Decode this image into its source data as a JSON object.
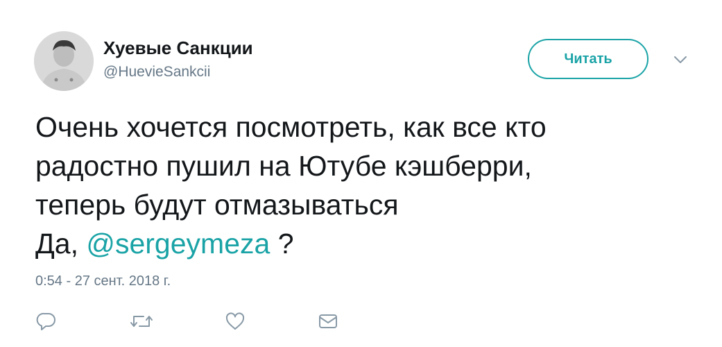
{
  "user": {
    "display_name": "Хуевые Санкции",
    "handle": "@HuevieSankcii"
  },
  "follow_button": {
    "label": "Читать"
  },
  "more_menu": {
    "icon": "chevron-down-icon"
  },
  "tweet": {
    "lines": [
      "Очень хочется посмотреть, как все кто",
      "радостно пушил на Ютубе кэшберри,",
      "теперь будут отмазываться"
    ],
    "last_line_prefix": "Да, ",
    "mention": "@sergeymeza",
    "last_line_suffix": " ?",
    "timestamp": "0:54 - 27 сент. 2018 г."
  },
  "actions": [
    {
      "name": "reply",
      "icon": "reply-icon"
    },
    {
      "name": "retweet",
      "icon": "retweet-icon"
    },
    {
      "name": "like",
      "icon": "heart-icon"
    },
    {
      "name": "direct-message",
      "icon": "envelope-icon"
    }
  ],
  "colors": {
    "accent": "#1aa3a6",
    "text": "#14171a",
    "secondary": "#657786"
  }
}
